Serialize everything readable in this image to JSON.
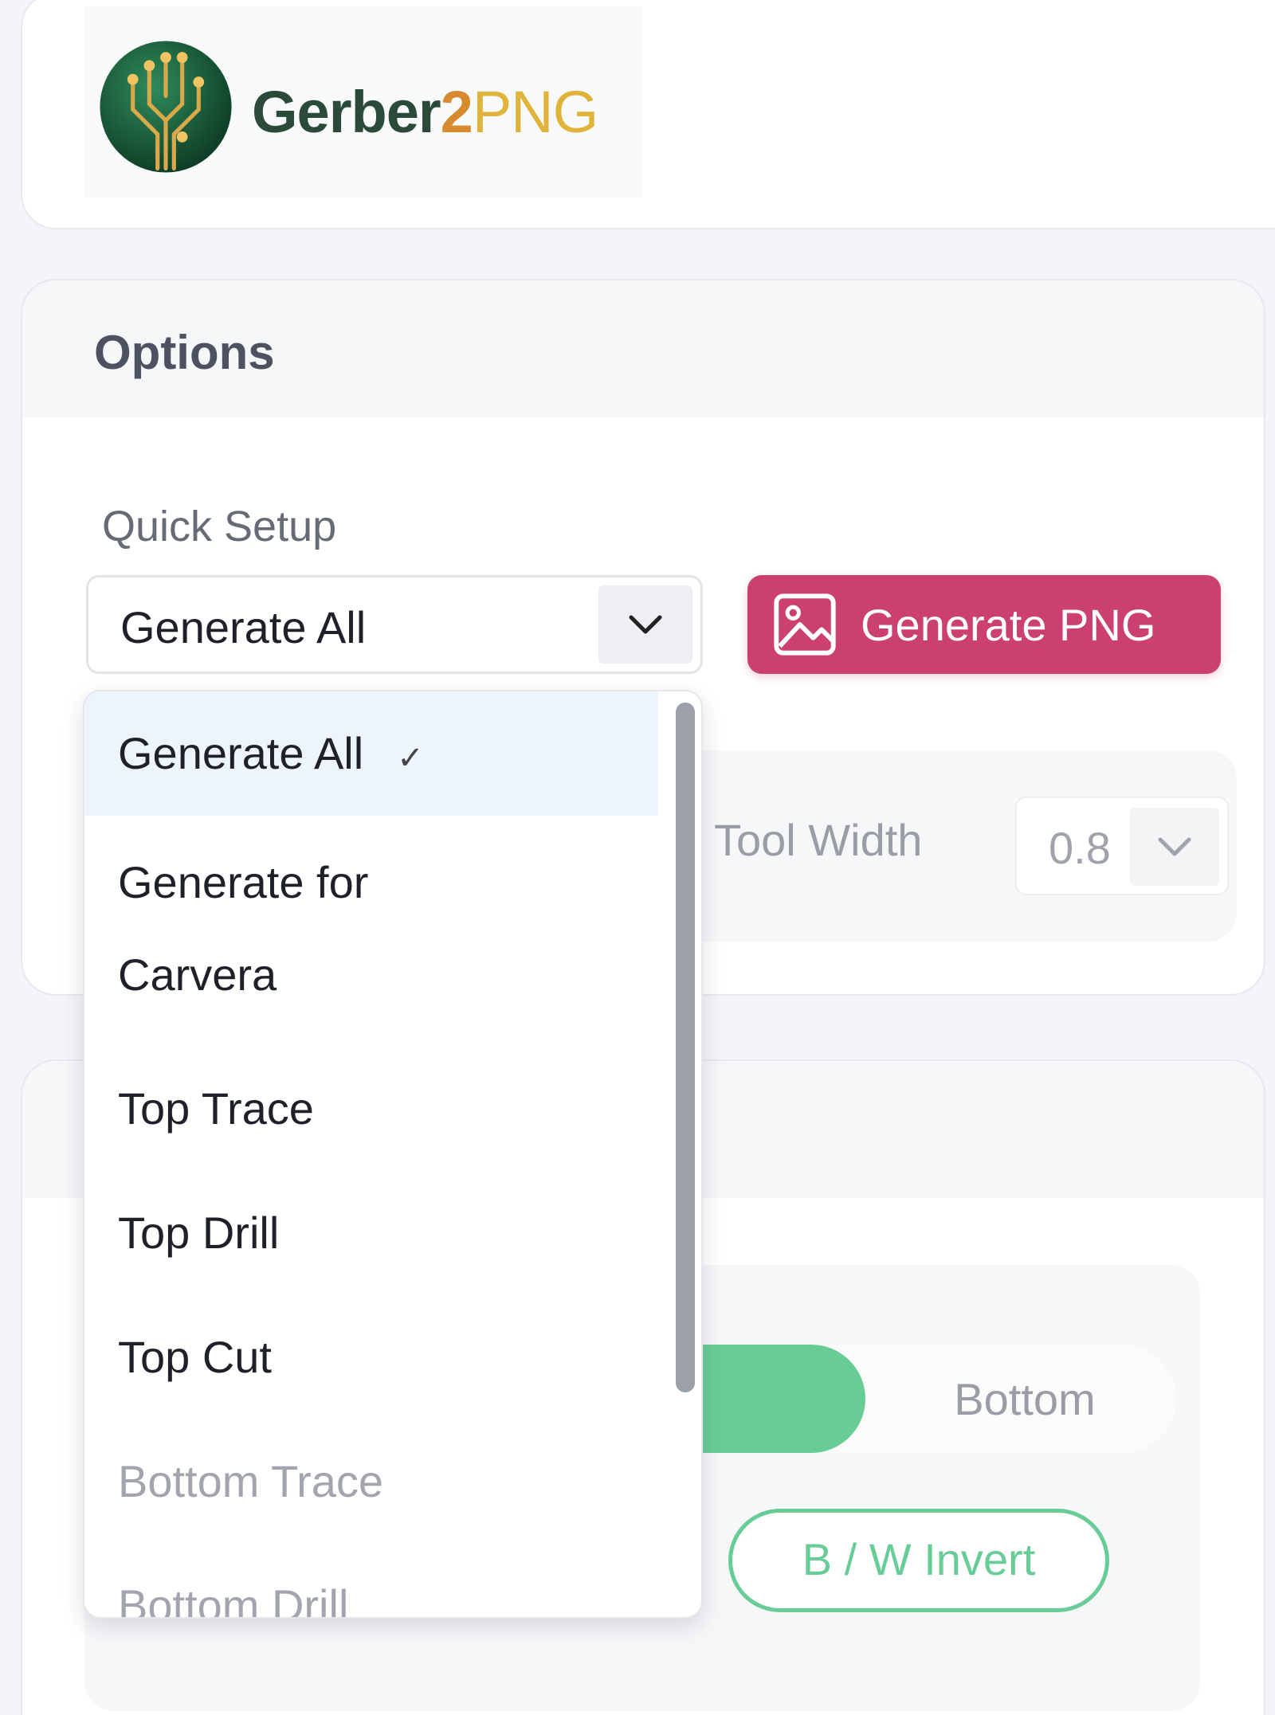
{
  "header": {
    "logo": {
      "text_part1": "Gerber",
      "text_part2": "2",
      "text_part3": "PNG",
      "colors": {
        "dark": "#2b4a3a",
        "orange": "#d88a2e",
        "gold": "#e0b33a"
      }
    }
  },
  "options": {
    "title": "Options",
    "quick_setup": {
      "label": "Quick Setup",
      "selected": "Generate All",
      "icon": "chevron-down-icon"
    },
    "generate_button": {
      "label": "Generate PNG",
      "icon": "image-icon",
      "color": "#cc3f71"
    },
    "tool_width": {
      "label": "Tool Width",
      "value": "0.8",
      "icon": "chevron-down-icon"
    }
  },
  "layer_side": {
    "active": "Top",
    "bottom_label": "Bottom",
    "accent": "#68cc97",
    "invert_label": "B / W Invert"
  },
  "dropdown": {
    "items": [
      {
        "label": "Generate All",
        "selected": true,
        "check": "✓"
      },
      {
        "label": "Generate for",
        "label_line2": "Carvera"
      },
      {
        "label": "Top Trace"
      },
      {
        "label": "Top Drill"
      },
      {
        "label": "Top Cut"
      },
      {
        "label": "Bottom Trace"
      },
      {
        "label": "Bottom Drill"
      }
    ]
  }
}
